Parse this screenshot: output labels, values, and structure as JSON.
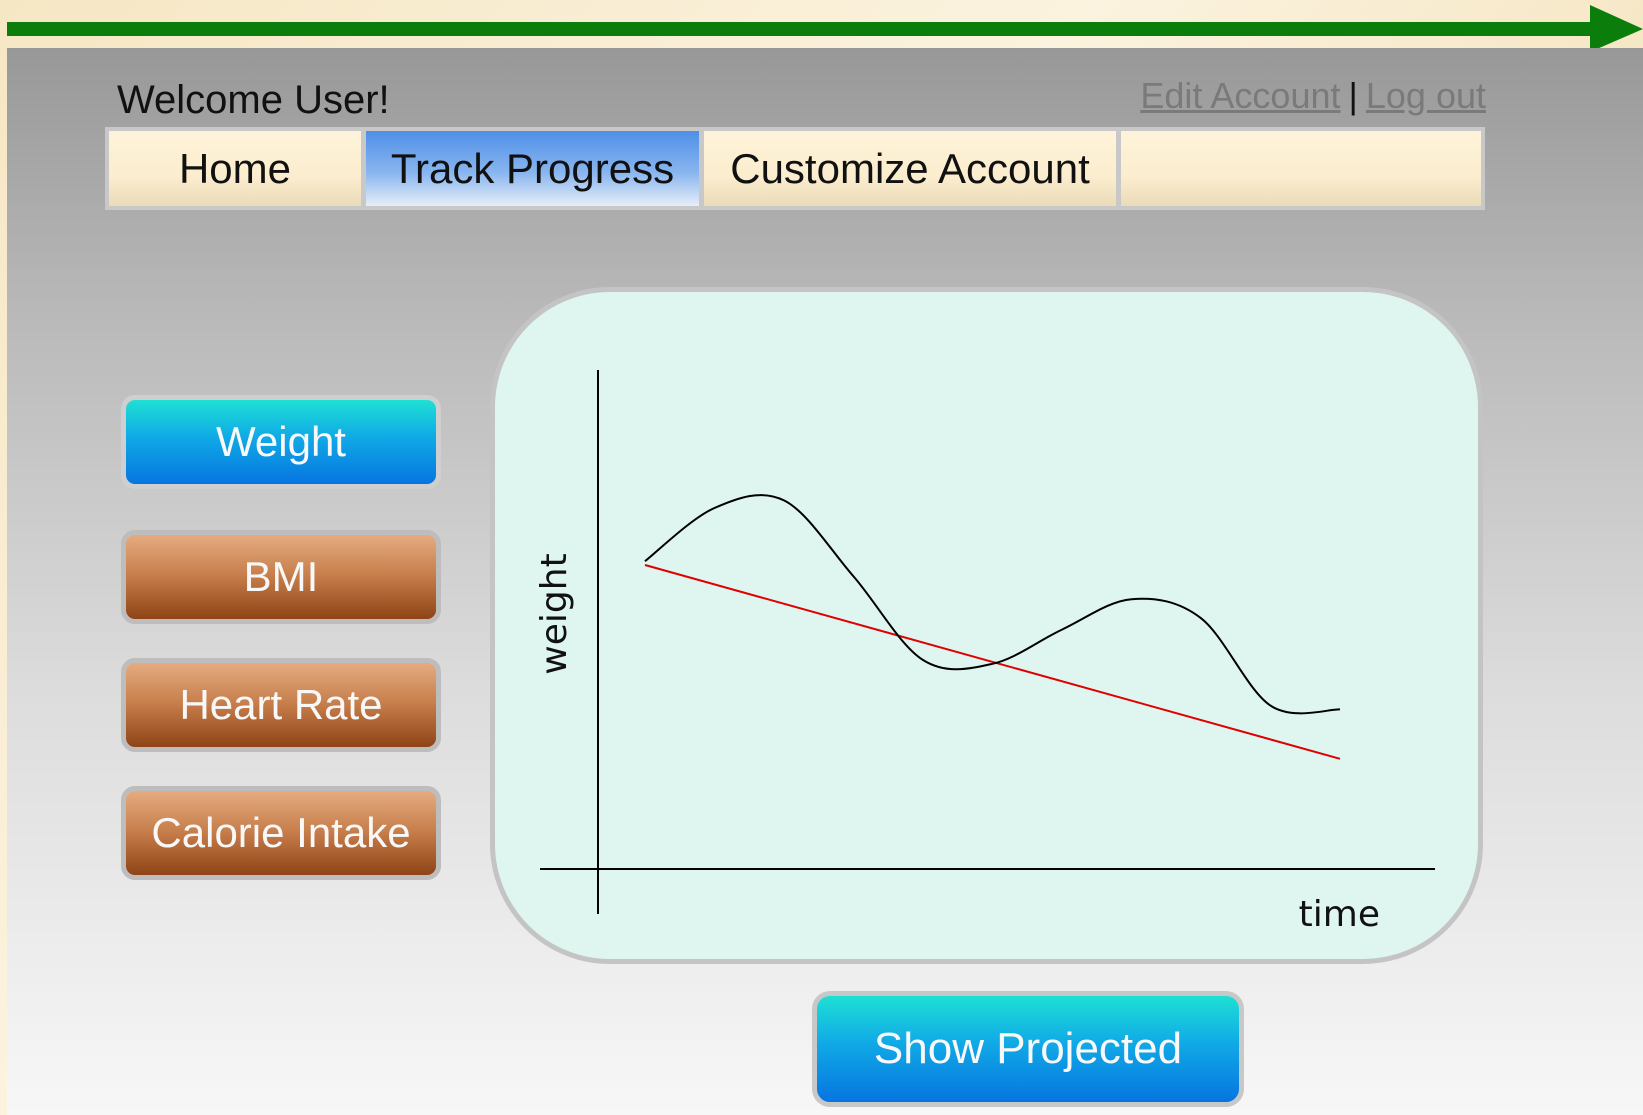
{
  "header": {
    "welcome": "Welcome User!",
    "edit_account": "Edit Account",
    "separator": "|",
    "log_out": "Log out"
  },
  "nav": {
    "tabs": [
      {
        "label": "Home",
        "active": false
      },
      {
        "label": "Track Progress",
        "active": true
      },
      {
        "label": "Customize Account",
        "active": false
      },
      {
        "label": "",
        "active": false
      }
    ]
  },
  "metrics": {
    "items": [
      {
        "label": "Weight",
        "selected": true
      },
      {
        "label": "BMI",
        "selected": false
      },
      {
        "label": "Heart Rate",
        "selected": false
      },
      {
        "label": "Calorie Intake",
        "selected": false
      }
    ]
  },
  "chart": {
    "xlabel": "time",
    "ylabel": "weight"
  },
  "chart_data": {
    "type": "line",
    "xlabel": "time",
    "ylabel": "weight",
    "series": [
      {
        "values": [
          0.66,
          0.8,
          0.82,
          0.62,
          0.4,
          0.39,
          0.48,
          0.56,
          0.51,
          0.28,
          0.27
        ]
      },
      {
        "values": [
          0.65,
          0.14
        ]
      }
    ],
    "colors": {
      "actual": "#000000",
      "trend": "#e00000"
    }
  },
  "actions": {
    "show_projected": "Show Projected"
  },
  "colors": {
    "progress_arrow": "#0a7d0a",
    "active_button": "#10a9e6",
    "inactive_button": "#b3683a",
    "active_tab": "#5f9ce8"
  }
}
